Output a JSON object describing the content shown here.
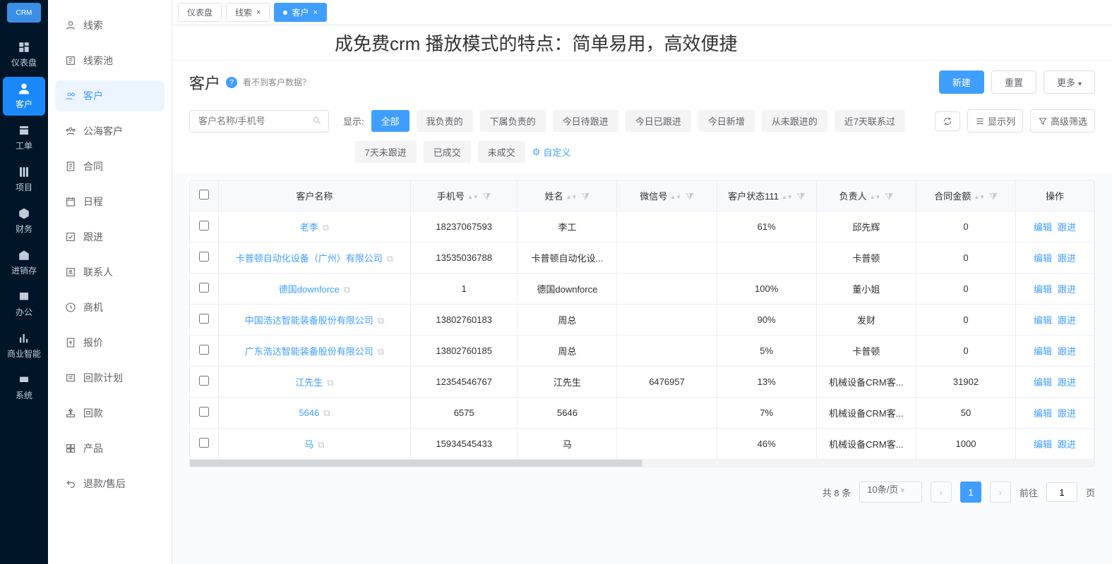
{
  "logo_text": "CRM",
  "nav": [
    {
      "label": "仪表盘"
    },
    {
      "label": "客户"
    },
    {
      "label": "工单"
    },
    {
      "label": "项目"
    },
    {
      "label": "财务"
    },
    {
      "label": "进销存"
    },
    {
      "label": "办公"
    },
    {
      "label": "商业智能"
    },
    {
      "label": "系统"
    }
  ],
  "sidebar": [
    {
      "label": "线索"
    },
    {
      "label": "线索池"
    },
    {
      "label": "客户"
    },
    {
      "label": "公海客户"
    },
    {
      "label": "合同"
    },
    {
      "label": "日程"
    },
    {
      "label": "跟进"
    },
    {
      "label": "联系人"
    },
    {
      "label": "商机"
    },
    {
      "label": "报价"
    },
    {
      "label": "回款计划"
    },
    {
      "label": "回款"
    },
    {
      "label": "产品"
    },
    {
      "label": "退款/售后"
    }
  ],
  "tabs": [
    {
      "label": "仪表盘"
    },
    {
      "label": "线索"
    },
    {
      "label": "客户"
    }
  ],
  "banner": "成免费crm 播放模式的特点：简单易用，高效便捷",
  "page": {
    "title": "客户",
    "hint": "看不到客户数据？",
    "btn_new": "新建",
    "btn_reset": "重置",
    "btn_more": "更多"
  },
  "filter": {
    "search_placeholder": "客户名称/手机号",
    "label": "显示:",
    "chips": [
      "全部",
      "我负责的",
      "下属负责的",
      "今日待跟进",
      "今日已跟进",
      "今日新增",
      "从未跟进的",
      "近7天联系过"
    ],
    "chips2": [
      "7天未跟进",
      "已成交",
      "未成交"
    ],
    "custom": "自定义",
    "tool_cols": "显示列",
    "tool_adv": "高级筛选"
  },
  "columns": [
    "客户名称",
    "手机号",
    "姓名",
    "微信号",
    "客户状态111",
    "负责人",
    "合同金额",
    "操作"
  ],
  "actions": {
    "edit": "编辑",
    "follow": "跟进"
  },
  "rows": [
    {
      "name": "老李",
      "phone": "18237067593",
      "contact": "李工",
      "wechat": "",
      "status": "61%",
      "owner": "邱先辉",
      "amount": "0"
    },
    {
      "name": "卡普顿自动化设备（广州）有限公司",
      "phone": "13535036788",
      "contact": "卡普顿自动化设...",
      "wechat": "",
      "status": "",
      "owner": "卡普顿",
      "amount": "0"
    },
    {
      "name": "德国downforce",
      "phone": "1",
      "contact": "德国downforce",
      "wechat": "",
      "status": "100%",
      "owner": "董小姐",
      "amount": "0"
    },
    {
      "name": "中国浩达智能装备股份有限公司",
      "phone": "13802760183",
      "contact": "周总",
      "wechat": "",
      "status": "90%",
      "owner": "发财",
      "amount": "0"
    },
    {
      "name": "广东浩达智能装备股份有限公司",
      "phone": "13802760185",
      "contact": "周总",
      "wechat": "",
      "status": "5%",
      "owner": "卡普顿",
      "amount": "0"
    },
    {
      "name": "江先生",
      "phone": "12354546767",
      "contact": "江先生",
      "wechat": "6476957",
      "status": "13%",
      "owner": "机械设备CRM客...",
      "amount": "31902"
    },
    {
      "name": "5646",
      "phone": "6575",
      "contact": "5646",
      "wechat": "",
      "status": "7%",
      "owner": "机械设备CRM客...",
      "amount": "50"
    },
    {
      "name": "马",
      "phone": "15934545433",
      "contact": "马",
      "wechat": "",
      "status": "46%",
      "owner": "机械设备CRM客...",
      "amount": "1000"
    }
  ],
  "pagination": {
    "total_text": "共 8 条",
    "per_page": "10条/页",
    "current": "1",
    "goto_label": "前往",
    "suffix": "页"
  }
}
